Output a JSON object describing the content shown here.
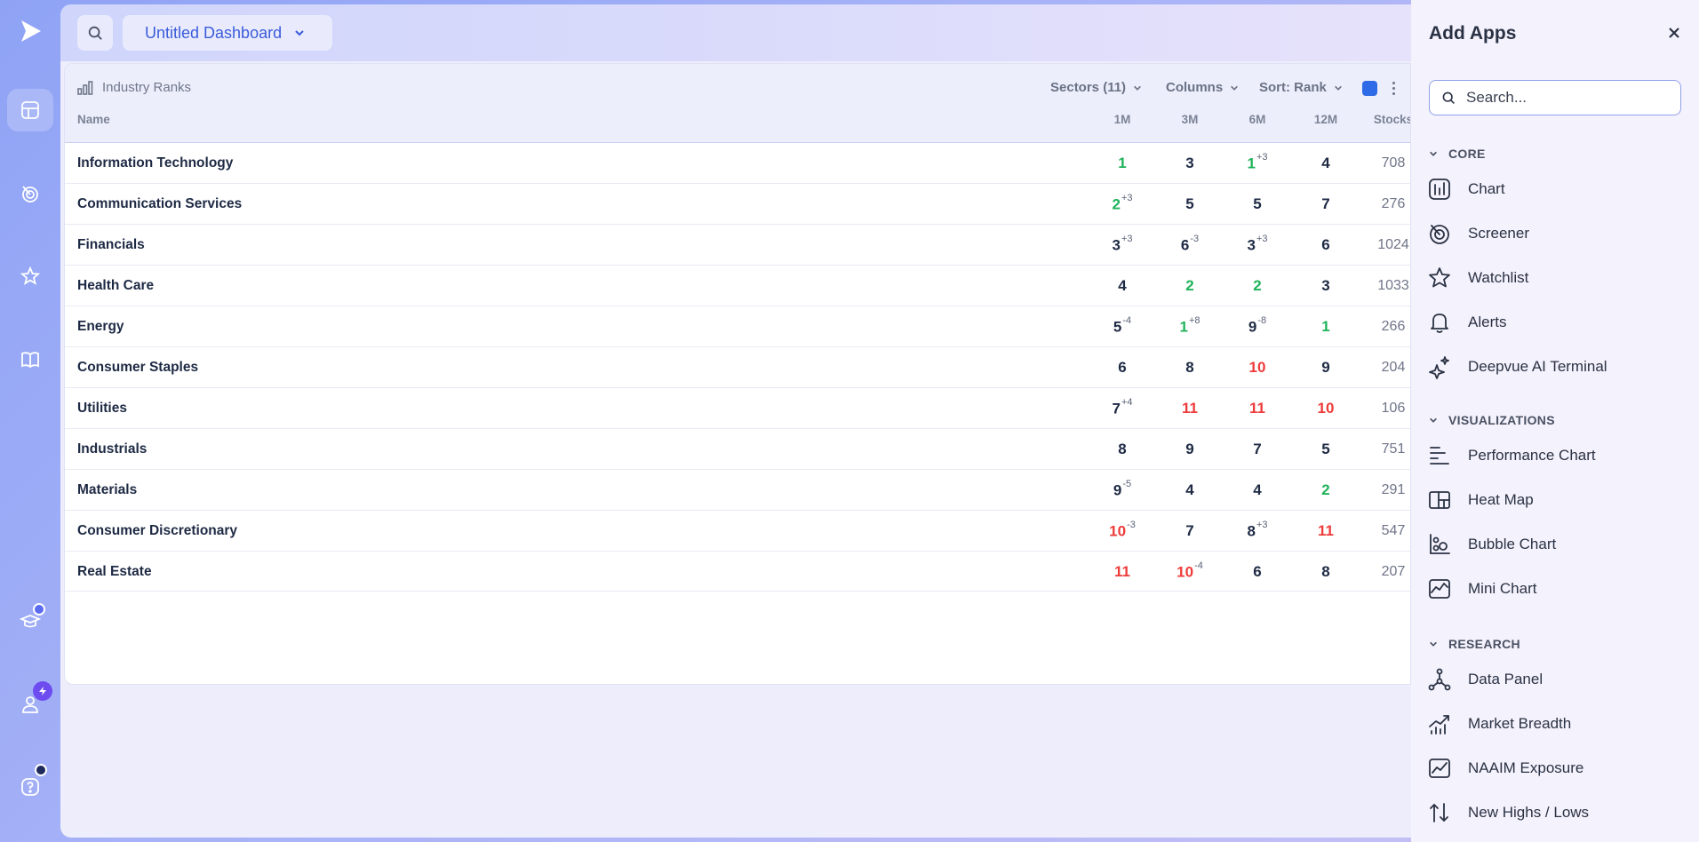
{
  "sidebar": {
    "items": [
      "dashboard",
      "screener",
      "watchlist",
      "docs",
      "learn",
      "account",
      "help"
    ]
  },
  "header": {
    "dashboard_name": "Untitled Dashboard"
  },
  "panel": {
    "title": "Industry Ranks",
    "controls": {
      "sectors": "Sectors (11)",
      "columns": "Columns",
      "sort": "Sort: Rank",
      "accent_color": "#2f6be6"
    },
    "columns": [
      "Name",
      "1M",
      "3M",
      "6M",
      "12M",
      "Stocks"
    ],
    "rows": [
      {
        "name": "Information Technology",
        "m1": {
          "v": "1",
          "d": "",
          "c": "green"
        },
        "m3": {
          "v": "3",
          "d": "",
          "c": "dark"
        },
        "m6": {
          "v": "1",
          "d": "+3",
          "c": "green"
        },
        "m12": {
          "v": "4",
          "d": "",
          "c": "dark"
        },
        "stocks": "708"
      },
      {
        "name": "Communication Services",
        "m1": {
          "v": "2",
          "d": "+3",
          "c": "green"
        },
        "m3": {
          "v": "5",
          "d": "",
          "c": "dark"
        },
        "m6": {
          "v": "5",
          "d": "",
          "c": "dark"
        },
        "m12": {
          "v": "7",
          "d": "",
          "c": "dark"
        },
        "stocks": "276"
      },
      {
        "name": "Financials",
        "m1": {
          "v": "3",
          "d": "+3",
          "c": "dark"
        },
        "m3": {
          "v": "6",
          "d": "-3",
          "c": "dark"
        },
        "m6": {
          "v": "3",
          "d": "+3",
          "c": "dark"
        },
        "m12": {
          "v": "6",
          "d": "",
          "c": "dark"
        },
        "stocks": "1024"
      },
      {
        "name": "Health Care",
        "m1": {
          "v": "4",
          "d": "",
          "c": "dark"
        },
        "m3": {
          "v": "2",
          "d": "",
          "c": "green"
        },
        "m6": {
          "v": "2",
          "d": "",
          "c": "green"
        },
        "m12": {
          "v": "3",
          "d": "",
          "c": "dark"
        },
        "stocks": "1033"
      },
      {
        "name": "Energy",
        "m1": {
          "v": "5",
          "d": "-4",
          "c": "dark"
        },
        "m3": {
          "v": "1",
          "d": "+8",
          "c": "green"
        },
        "m6": {
          "v": "9",
          "d": "-8",
          "c": "dark"
        },
        "m12": {
          "v": "1",
          "d": "",
          "c": "green"
        },
        "stocks": "266"
      },
      {
        "name": "Consumer Staples",
        "m1": {
          "v": "6",
          "d": "",
          "c": "dark"
        },
        "m3": {
          "v": "8",
          "d": "",
          "c": "dark"
        },
        "m6": {
          "v": "10",
          "d": "",
          "c": "red"
        },
        "m12": {
          "v": "9",
          "d": "",
          "c": "dark"
        },
        "stocks": "204"
      },
      {
        "name": "Utilities",
        "m1": {
          "v": "7",
          "d": "+4",
          "c": "dark"
        },
        "m3": {
          "v": "11",
          "d": "",
          "c": "red"
        },
        "m6": {
          "v": "11",
          "d": "",
          "c": "red"
        },
        "m12": {
          "v": "10",
          "d": "",
          "c": "red"
        },
        "stocks": "106"
      },
      {
        "name": "Industrials",
        "m1": {
          "v": "8",
          "d": "",
          "c": "dark"
        },
        "m3": {
          "v": "9",
          "d": "",
          "c": "dark"
        },
        "m6": {
          "v": "7",
          "d": "",
          "c": "dark"
        },
        "m12": {
          "v": "5",
          "d": "",
          "c": "dark"
        },
        "stocks": "751"
      },
      {
        "name": "Materials",
        "m1": {
          "v": "9",
          "d": "-5",
          "c": "dark"
        },
        "m3": {
          "v": "4",
          "d": "",
          "c": "dark"
        },
        "m6": {
          "v": "4",
          "d": "",
          "c": "dark"
        },
        "m12": {
          "v": "2",
          "d": "",
          "c": "green"
        },
        "stocks": "291"
      },
      {
        "name": "Consumer Discretionary",
        "m1": {
          "v": "10",
          "d": "-3",
          "c": "red"
        },
        "m3": {
          "v": "7",
          "d": "",
          "c": "dark"
        },
        "m6": {
          "v": "8",
          "d": "+3",
          "c": "dark"
        },
        "m12": {
          "v": "11",
          "d": "",
          "c": "red"
        },
        "stocks": "547"
      },
      {
        "name": "Real Estate",
        "m1": {
          "v": "11",
          "d": "",
          "c": "red"
        },
        "m3": {
          "v": "10",
          "d": "-4",
          "c": "red"
        },
        "m6": {
          "v": "6",
          "d": "",
          "c": "dark"
        },
        "m12": {
          "v": "8",
          "d": "",
          "c": "dark"
        },
        "stocks": "207"
      }
    ]
  },
  "drawer": {
    "title": "Add Apps",
    "search_placeholder": "Search...",
    "sections": [
      {
        "label": "CORE",
        "items": [
          {
            "label": "Chart",
            "icon": "chart-icon"
          },
          {
            "label": "Screener",
            "icon": "screener-icon"
          },
          {
            "label": "Watchlist",
            "icon": "star-icon"
          },
          {
            "label": "Alerts",
            "icon": "bell-icon"
          },
          {
            "label": "Deepvue AI Terminal",
            "icon": "sparkles-icon"
          }
        ]
      },
      {
        "label": "VISUALIZATIONS",
        "items": [
          {
            "label": "Performance Chart",
            "icon": "bars-horizontal-icon"
          },
          {
            "label": "Heat Map",
            "icon": "heatmap-icon"
          },
          {
            "label": "Bubble Chart",
            "icon": "bubble-icon"
          },
          {
            "label": "Mini Chart",
            "icon": "mini-chart-icon"
          }
        ]
      },
      {
        "label": "RESEARCH",
        "items": [
          {
            "label": "Data Panel",
            "icon": "nodes-icon"
          },
          {
            "label": "Market Breadth",
            "icon": "breadth-icon"
          },
          {
            "label": "NAAIM Exposure",
            "icon": "line-chart-icon"
          },
          {
            "label": "New Highs / Lows",
            "icon": "arrows-updown-icon"
          }
        ]
      }
    ]
  },
  "colors": {
    "green": "#1fb35a",
    "red": "#ee3b3b",
    "dark": "#1e2a44",
    "brand": "#3b5bd9"
  }
}
